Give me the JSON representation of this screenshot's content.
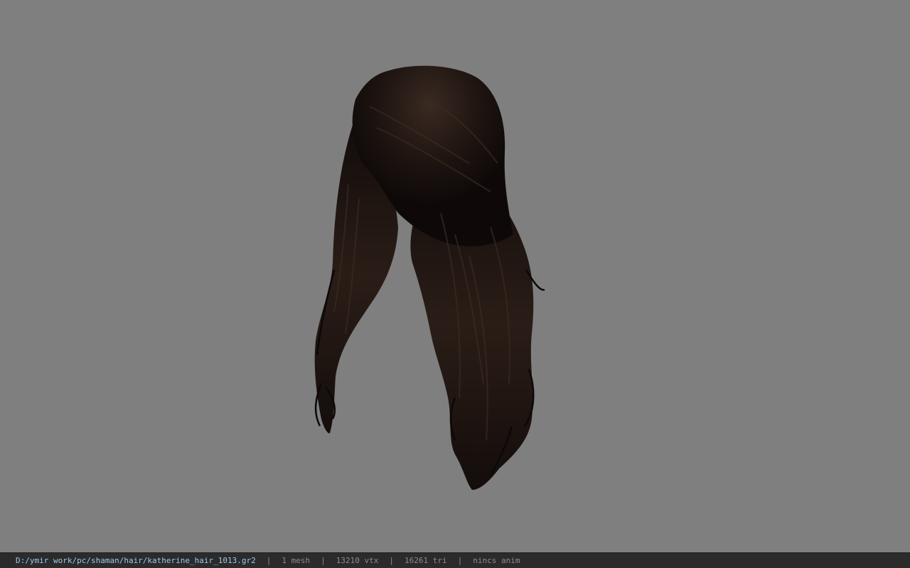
{
  "viewport": {
    "background": "#7f7f7f",
    "model": "hair-mesh"
  },
  "statusbar": {
    "file_path": "D:/ymir work/pc/shaman/hair/katherine_hair_1013.gr2",
    "separator": "|",
    "meshes": "1 mesh",
    "vertices": "13210 vtx",
    "triangles": "16261 tri",
    "anim": "nincs anim",
    "path_color": "#9fc7e8",
    "bar_color": "#2b2b2b"
  }
}
